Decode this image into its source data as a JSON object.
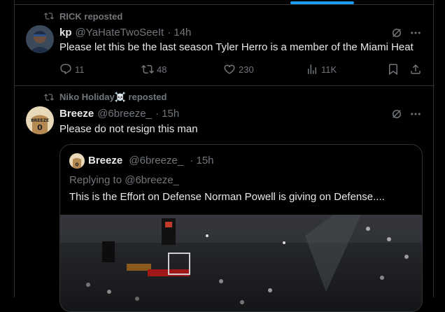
{
  "tweet1": {
    "repost_text": "RICK reposted",
    "name": "kp",
    "handle": "@YaHateTwoSeeIt",
    "time": "· 14h",
    "text": "Please let this be the last season Tyler Herro is a member of the Miami Heat",
    "replies": "11",
    "reposts": "48",
    "likes": "230",
    "views": "11K"
  },
  "tweet2": {
    "repost_text": "Niko Holiday☠️ reposted",
    "name": "Breeze",
    "handle": "@6breeze_",
    "time": "· 15h",
    "text": "Please do not resign this man",
    "quote": {
      "name": "Breeze",
      "handle": "@6breeze_",
      "time": "· 15h",
      "reply_to": "Replying to @6breeze_",
      "text": "This is the Effort on Defense Norman Powell is giving on Defense...."
    }
  },
  "colors": {
    "background": "#000000",
    "border": "#2f3336",
    "text_primary": "#e7e9ea",
    "text_secondary": "#71767b",
    "accent": "#1d9bf0"
  },
  "icons": [
    "repost-icon",
    "grok-icon",
    "more-icon",
    "reply-icon",
    "like-icon",
    "views-icon",
    "bookmark-icon",
    "share-icon"
  ]
}
